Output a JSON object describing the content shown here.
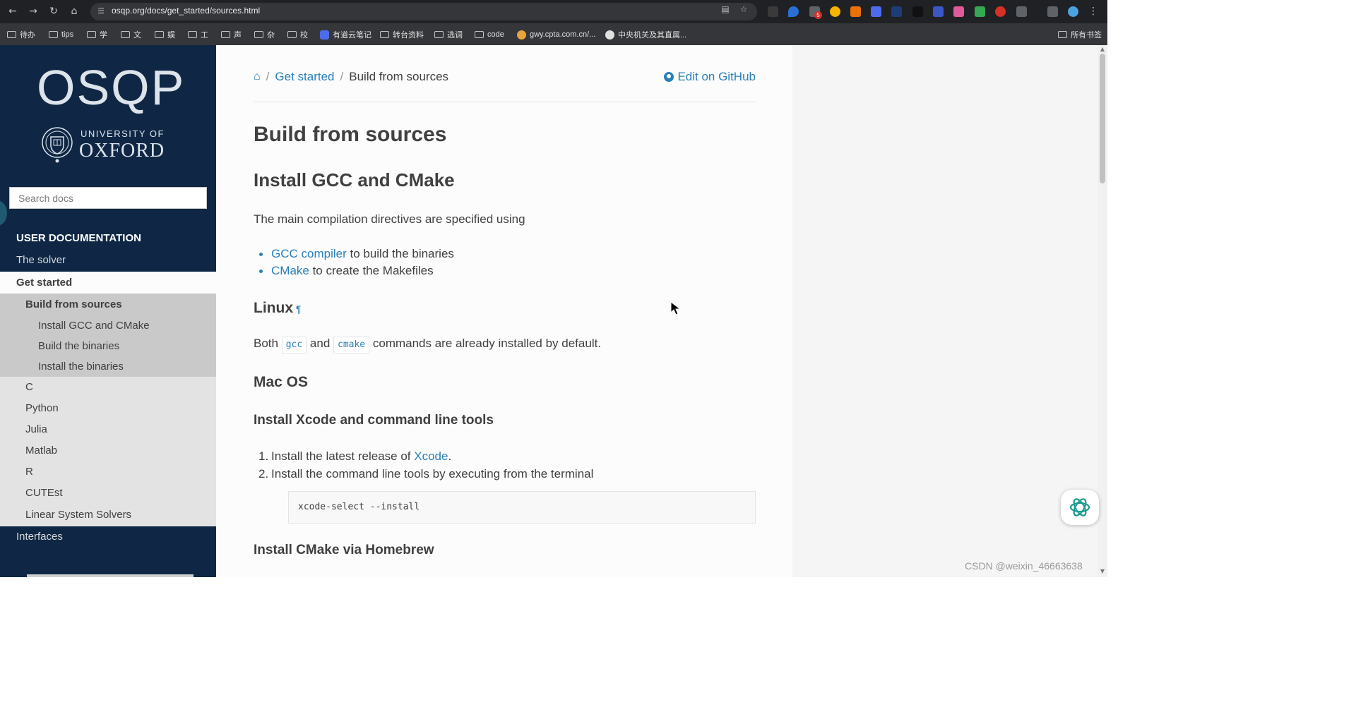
{
  "browser": {
    "url": "osqp.org/docs/get_started/sources.html",
    "extension_badge": "5",
    "bookmarks": [
      "待办",
      "tips",
      "学",
      "文",
      "娱",
      "工",
      "声",
      "杂",
      "校",
      "有道云笔记",
      "转台资料",
      "选调",
      "code",
      "gwy.cpta.com.cn/...",
      "中央机关及其直属...",
      "所有书签"
    ]
  },
  "sidebar": {
    "logo": "OSQP",
    "university_line1": "UNIVERSITY OF",
    "university_line2": "OXFORD",
    "search_placeholder": "Search docs",
    "caption": "USER DOCUMENTATION",
    "items": [
      {
        "label": "The solver"
      },
      {
        "label": "Get started"
      },
      {
        "label": "Build from sources"
      },
      {
        "label": "Install GCC and CMake"
      },
      {
        "label": "Build the binaries"
      },
      {
        "label": "Install the binaries"
      },
      {
        "label": "C"
      },
      {
        "label": "Python"
      },
      {
        "label": "Julia"
      },
      {
        "label": "Matlab"
      },
      {
        "label": "R"
      },
      {
        "label": "CUTEst"
      },
      {
        "label": "Linear System Solvers"
      },
      {
        "label": "Interfaces"
      }
    ]
  },
  "breadcrumb": {
    "parent": "Get started",
    "separator": "/",
    "current": "Build from sources",
    "edit": "Edit on GitHub"
  },
  "content": {
    "title": "Build from sources",
    "section1": "Install GCC and CMake",
    "intro": "The main compilation directives are specified using",
    "bullets": [
      {
        "link": "GCC compiler",
        "text": " to build the binaries"
      },
      {
        "link": "CMake",
        "text": " to create the Makefiles"
      }
    ],
    "linux_heading": "Linux",
    "pilcrow": "¶",
    "linux_text": {
      "pre": "Both ",
      "code1": "gcc",
      "mid": " and ",
      "code2": "cmake",
      "post": " commands are already installed by default."
    },
    "mac_heading": "Mac OS",
    "xcode_heading": "Install Xcode and command line tools",
    "steps": [
      {
        "num": "1.",
        "pre": "Install the latest release of ",
        "link": "Xcode",
        "post": "."
      },
      {
        "num": "2.",
        "pre": "Install the command line tools by executing from the terminal",
        "link": "",
        "post": ""
      }
    ],
    "code": "xcode-select --install",
    "homebrew_heading": "Install CMake via Homebrew"
  },
  "watermark": "CSDN @weixin_46663638",
  "colors": {
    "sidebar_dark": "#0f2745",
    "link": "#2980b9",
    "text": "#404040"
  }
}
